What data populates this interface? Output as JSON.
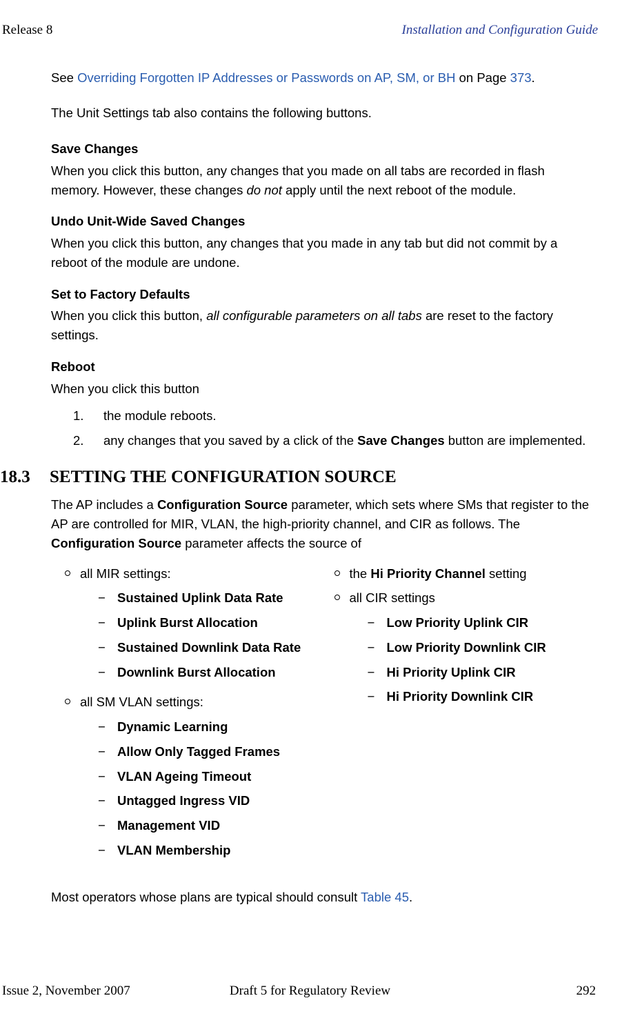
{
  "header": {
    "left": "Release 8",
    "right": "Installation and Configuration Guide"
  },
  "intro": {
    "see": "See ",
    "link": "Overriding Forgotten IP Addresses or Passwords on AP, SM, or BH",
    "on_page": " on Page ",
    "pagenum": "373",
    "period": "."
  },
  "para_unit_settings": "The Unit Settings tab also contains the following buttons.",
  "save_changes": {
    "title": "Save Changes",
    "body_pre": "When you click this button, any changes that you made on all tabs are recorded in flash memory. However, these changes ",
    "body_em": "do not",
    "body_post": " apply until the next reboot of the module."
  },
  "undo": {
    "title": "Undo Unit-Wide Saved Changes",
    "body": "When you click this button, any changes that you made in any tab but did not commit by a reboot of the module are undone."
  },
  "factory": {
    "title": "Set to Factory Defaults",
    "body_pre": "When you click this button, ",
    "body_em": "all configurable parameters on all tabs",
    "body_post": " are reset to the factory settings."
  },
  "reboot": {
    "title": "Reboot",
    "body": "When you click this button",
    "items": [
      {
        "num": "1.",
        "text": "the module reboots."
      },
      {
        "num": "2.",
        "text_pre": "any changes that you saved by a click of the ",
        "bold": "Save Changes",
        "text_post": " button are implemented."
      }
    ]
  },
  "section": {
    "num": "18.3",
    "title": "SETTING THE CONFIGURATION SOURCE"
  },
  "cs_para": {
    "p1a": "The AP includes a ",
    "p1b": "Configuration Source",
    "p1c": " parameter, which sets where SMs that register to the AP are controlled for MIR, VLAN, the high-priority channel, and CIR as follows. The ",
    "p1d": "Configuration Source",
    "p1e": " parameter affects the source of"
  },
  "col1": {
    "mir_head": "all MIR settings:",
    "mir_items": [
      "Sustained Uplink Data Rate",
      "Uplink Burst Allocation",
      "Sustained Downlink Data Rate",
      "Downlink Burst Allocation"
    ],
    "vlan_head": "all SM VLAN settings:",
    "vlan_items": [
      "Dynamic Learning",
      "Allow Only Tagged Frames",
      "VLAN Ageing Timeout",
      "Untagged Ingress VID",
      "Management VID",
      "VLAN Membership"
    ]
  },
  "col2": {
    "hpc_pre": "the ",
    "hpc_bold": "Hi Priority Channel",
    "hpc_post": " setting",
    "cir_head": "all CIR settings",
    "cir_items": [
      "Low Priority Uplink CIR",
      "Low Priority Downlink CIR",
      "Hi Priority Uplink CIR",
      "Hi Priority Downlink CIR"
    ]
  },
  "consult": {
    "pre": "Most operators whose plans are typical should consult ",
    "link": "Table 45",
    "post": "."
  },
  "footer": {
    "left": "Issue 2, November 2007",
    "center": "Draft 5 for Regulatory Review",
    "right": "292"
  },
  "dash": "−"
}
